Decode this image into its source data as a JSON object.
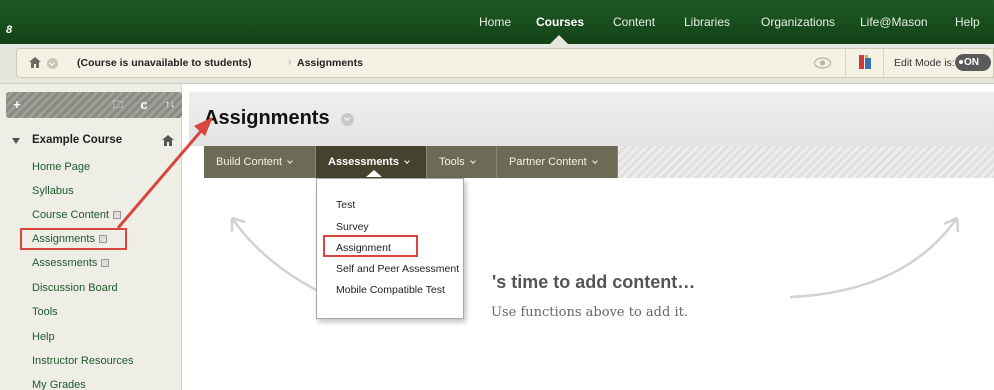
{
  "topnav": {
    "logo": "8",
    "items": [
      "Home",
      "Courses",
      "Content",
      "Libraries",
      "Organizations",
      "Life@Mason",
      "Help"
    ],
    "active": "Courses"
  },
  "breadcrumb": {
    "course_status": "(Course is unavailable to students)",
    "separator": "›",
    "current": "Assignments",
    "edit_mode_label": "Edit Mode is:",
    "edit_mode_value": "ON"
  },
  "sidebar": {
    "toolbar": {
      "add": "+",
      "folder": "🗀",
      "refresh": "c",
      "sort": "↑↓"
    },
    "course_title": "Example Course",
    "items": [
      {
        "label": "Home Page"
      },
      {
        "label": "Syllabus"
      },
      {
        "label": "Course Content"
      },
      {
        "label": "Assignments"
      },
      {
        "label": "Assessments"
      },
      {
        "label": "Discussion Board"
      },
      {
        "label": "Tools"
      },
      {
        "label": "Help"
      },
      {
        "label": "Instructor Resources"
      },
      {
        "label": "My Grades"
      }
    ]
  },
  "main": {
    "title": "Assignments",
    "action_bar": [
      "Build Content",
      "Assessments",
      "Tools",
      "Partner Content"
    ],
    "open_menu": "Assessments",
    "dropdown": [
      "Test",
      "Survey",
      "Assignment",
      "Self and Peer Assessment",
      "Mobile Compatible Test"
    ],
    "empty_heading": "'s time to add content…",
    "empty_sub": "Use functions above to add it."
  },
  "colors": {
    "topbar": "#1f5a24",
    "link": "#1c5b2d",
    "action_bar": "#6d6a55",
    "annotation": "#d9453f"
  }
}
